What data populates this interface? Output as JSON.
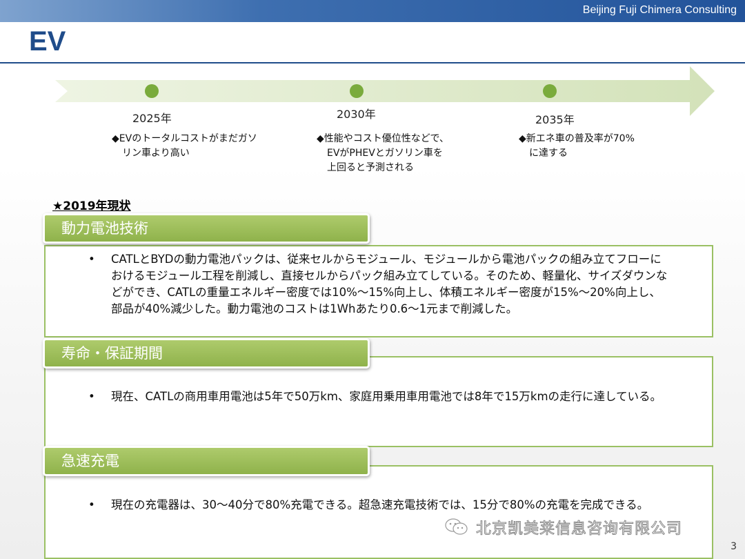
{
  "header": {
    "company": "Beijing Fuji Chimera Consulting",
    "title": "EV"
  },
  "timeline": {
    "milestones": [
      {
        "year": "2025年",
        "lines": [
          "◆EVのトータルコストがまだガソ",
          "リン車より高い"
        ]
      },
      {
        "year": "2030年",
        "lines": [
          "◆性能やコスト優位性などで、",
          "EVがPHEVとガソリン車を",
          "上回ると予測される"
        ]
      },
      {
        "year": "2035年",
        "lines": [
          "◆新エネ車の普及率が70%",
          "に達する"
        ]
      }
    ]
  },
  "status_heading": "★2019年現状",
  "sections": [
    {
      "tab": "動力電池技術",
      "bullet": "•",
      "text": "CATLとBYDの動力電池パックは、従来セルからモジュール、モジュールから電池パックの組み立てフローにおけるモジュール工程を削減し、直接セルからパック組み立てしている。そのため、軽量化、サイズダウンなどができ、CATLの重量エネルギー密度では10%～15%向上し、体積エネルギー密度が15%～20%向上し、部品が40%減少した。動力電池のコストは1Whあたり0.6～1元まで削減した。"
    },
    {
      "tab": "寿命・保証期間",
      "bullet": "•",
      "text": "現在、CATLの商用車用電池は5年で50万km、家庭用乗用車用電池では8年で15万kmの走行に達している。"
    },
    {
      "tab": "急速充電",
      "bullet": "•",
      "text": "現在の充電器は、30～40分で80%充電できる。超急速充電技術では、15分で80%の充電を完成できる。"
    }
  ],
  "watermark": "北京凯美莱信息咨询有限公司",
  "page_number": "3",
  "colors": {
    "accent_green": "#8fb24b",
    "title_blue": "#1f4c8a",
    "header_blue": "#22539a"
  }
}
